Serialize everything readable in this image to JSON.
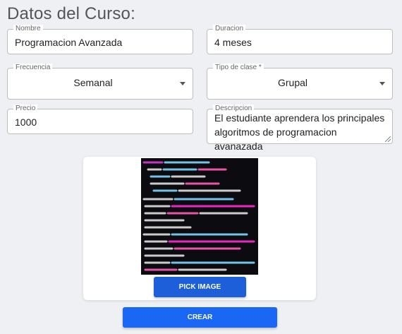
{
  "form": {
    "title": "Datos del Curso:",
    "nombre": {
      "label": "Nombre",
      "value": "Programacion Avanzada"
    },
    "duracion": {
      "label": "Duracion",
      "value": "4 meses"
    },
    "frecuencia": {
      "label": "Frecuencia",
      "value": "Semanal"
    },
    "tipo": {
      "label": "Tipo de clase *",
      "value": "Grupal"
    },
    "precio": {
      "label": "Precio",
      "value": "1000"
    },
    "descripcion": {
      "label": "Descripcion",
      "value": "El estudiante aprendera los principales algoritmos de programacion avanazada"
    }
  },
  "image_card": {
    "image_alt": "code-screenshot",
    "pick_label": "PICK IMAGE"
  },
  "actions": {
    "crear_label": "CREAR"
  },
  "colors": {
    "primary": "#1a66f5",
    "pick_button": "#1c5fd8",
    "background": "#eef0f3"
  }
}
